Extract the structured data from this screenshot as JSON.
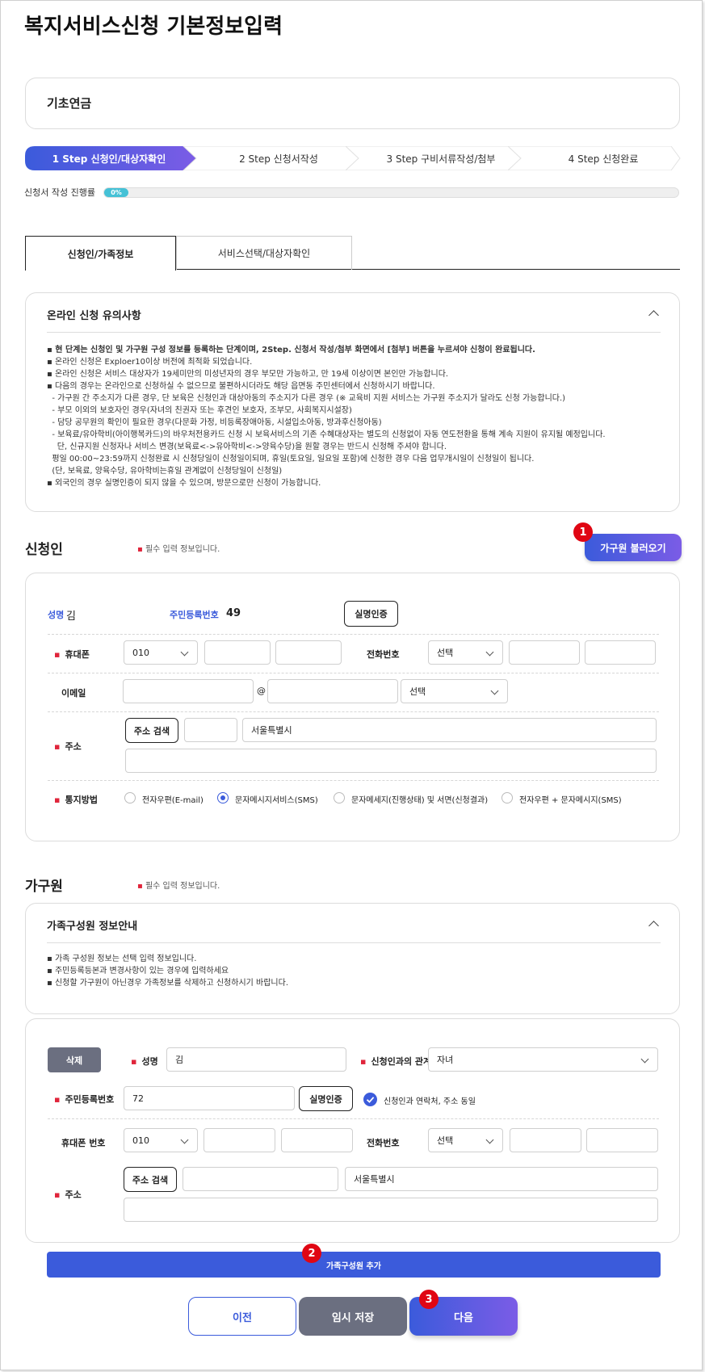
{
  "page": {
    "title": "복지서비스신청 기본정보입력"
  },
  "service": {
    "name": "기초연금"
  },
  "steps": [
    {
      "label": "1 Step 신청인/대상자확인",
      "active": true
    },
    {
      "label": "2 Step 신청서작성",
      "active": false
    },
    {
      "label": "3 Step 구비서류작성/첨부",
      "active": false
    },
    {
      "label": "4 Step 신청완료",
      "active": false
    }
  ],
  "progress": {
    "label": "신청서 작성 진행률",
    "value_text": "0%",
    "value": 0
  },
  "tabs": [
    {
      "label": "신청인/가족정보",
      "active": true
    },
    {
      "label": "서비스선택/대상자확인",
      "active": false
    }
  ],
  "notice": {
    "title": "온라인 신청 유의사항",
    "lines": [
      "▪ 현 단계는 신청인 및 가구원 구성 정보를 등록하는 단계이며, 2Step. 신청서 작성/첨부 화면에서 [첨부] 버튼을 누르셔야 신청이 완료됩니다.",
      "▪ 온라인 신청은 Exploer10이상 버전에 최적화 되었습니다.",
      "▪ 온라인 신청은 서비스 대상자가 19세미만의 미성년자의 경우 부모만 가능하고, 만 19세 이상이면 본인만 가능합니다.",
      "▪ 다음의 경우는 온라인으로 신청하실 수 없으므로 불편하시더라도 해당 읍면동 주민센터에서 신청하시기 바랍니다.",
      "  - 가구원 간 주소지가 다른 경우, 단 보육은 신청인과 대상아동의 주소지가 다른 경우 (※ 교육비 지원 서비스는 가구원 주소지가 달라도 신청 가능합니다.)",
      "  - 부모 이외의 보호자인 경우(자녀의 친권자 또는 후견인 보호자, 조부모, 사회복지시설장)",
      "  - 담당 공무원의 확인이 필요한 경우(다문화 가정, 비등록장애아동, 시설입소아동, 방과후신청아동)",
      "  - 보육료/유아학비(아이행복카드)의 바우처전용카드 신청 시 보육서비스의 기존 수혜대상자는 별도의 신청없이 자동 연도전환을 통해 계속 지원이 유지될 예정입니다.",
      "    단, 신규지원 신청자나 서비스 변경(보육료<->유아학비<->양육수당)을 원할 경우는 반드시 신청해 주셔야 합니다.",
      "  평일 00:00~23:59까지 신청완료 시 신청당일이 신청일이되며, 휴일(토요일, 일요일 포함)에 신청한 경우 다음 업무개시일이 신청일이 됩니다.",
      "  (단, 보육료, 양육수당, 유아학비는휴일 관계없이 신청당일이 신청일)",
      "▪ 외국인의 경우 실명인증이 되지 않을 수 있으며, 방문으로만 신청이 가능합니다."
    ]
  },
  "applicant": {
    "section_title": "신청인",
    "required_note": "필수 입력 정보입니다.",
    "load_family_button": "가구원 불러오기",
    "name_label": "성명",
    "name_value": "김",
    "rrn_label": "주민등록번호",
    "rrn_value": "49",
    "verify_button": "실명인증",
    "mobile_label": "휴대폰",
    "mobile_prefix": "010",
    "phone_label": "전화번호",
    "phone_prefix": "선택",
    "email_label": "이메일",
    "email_at": "@",
    "email_domain": "선택",
    "address_label": "주소",
    "address_search_button": "주소 검색",
    "address_value": "서울특별시",
    "notify_label": "통지방법",
    "notify_options": [
      {
        "label": "전자우편(E-mail)",
        "checked": false
      },
      {
        "label": "문자메시지서비스(SMS)",
        "checked": true
      },
      {
        "label": "문자메세지(진행상태) 및 서면(신청결과)",
        "checked": false
      },
      {
        "label": "전자우편 + 문자메시지(SMS)",
        "checked": false
      }
    ]
  },
  "household": {
    "section_title": "가구원",
    "required_note": "필수 입력 정보입니다.",
    "info_title": "가족구성원 정보안내",
    "info_lines": [
      "▪ 가족 구성원 정보는 선택 입력 정보입니다.",
      "▪ 주민등록등본과 변경사항이 있는 경우에 입력하세요",
      "▪ 신청할 가구원이 아닌경우 가족정보를 삭제하고 신청하시기 바랍니다."
    ],
    "delete_button": "삭제",
    "name_label": "성명",
    "name_value": "김",
    "relation_label": "신청인과의 관계",
    "relation_value": "자녀",
    "rrn_label": "주민등록번호",
    "rrn_value": "72",
    "verify_button": "실명인증",
    "same_contact_label": "신청인과 연락처, 주소 동일",
    "mobile_label": "휴대폰 번호",
    "mobile_prefix": "010",
    "phone_label": "전화번호",
    "phone_prefix": "선택",
    "address_label": "주소",
    "address_search_button": "주소 검색",
    "address_value": "서울특별시",
    "add_member_button": "가족구성원 추가"
  },
  "footer": {
    "prev": "이전",
    "save": "임시 저장",
    "next": "다음"
  },
  "badges": [
    "1",
    "2",
    "3"
  ],
  "colors": {
    "primary": "#3b5bdb",
    "accent_purple": "#7b5ce6",
    "badge": "#e00613",
    "progress": "#45c1d6",
    "gray_button": "#6b6f80"
  }
}
